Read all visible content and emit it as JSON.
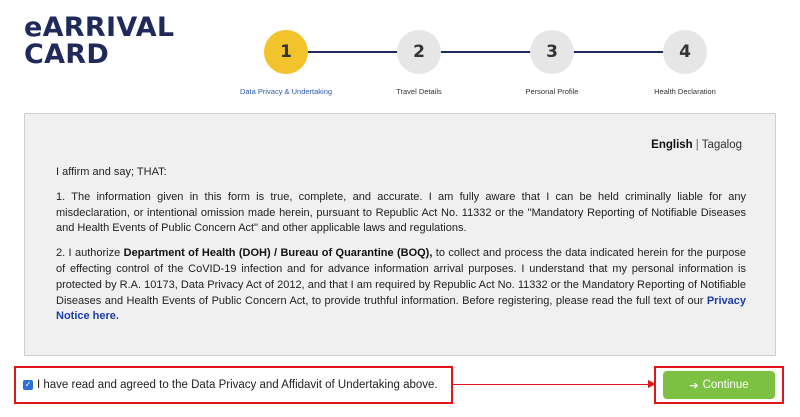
{
  "logo": {
    "line1": "eARRIVAL",
    "line2": "CARD"
  },
  "steps": [
    {
      "number": "1",
      "label": "Data Privacy & Undertaking",
      "active": true
    },
    {
      "number": "2",
      "label": "Travel Details",
      "active": false
    },
    {
      "number": "3",
      "label": "Personal Profile",
      "active": false
    },
    {
      "number": "4",
      "label": "Health Declaration",
      "active": false
    }
  ],
  "language": {
    "selected": "English",
    "separator": "|",
    "alternate": "Tagalog"
  },
  "content": {
    "intro": "I affirm and say; THAT:",
    "para1": "1. The information given in this form is true, complete, and accurate. I am fully aware that I can be held criminally liable for any misdeclaration, or intentional omission made herein, pursuant to Republic Act No. 11332 or the \"Mandatory Reporting of Notifiable Diseases and Health Events of Public Concern Act\" and other applicable laws and regulations.",
    "para2_prefix": "2. I authorize ",
    "para2_org": "Department of Health (DOH) / Bureau of Quarantine (BOQ),",
    "para2_body": " to collect and process the data indicated herein for the purpose of effecting control of the CoVID-19 infection and for advance information arrival purposes. I understand that my personal information is protected by R.A. 10173, Data Privacy Act of 2012, and that I am required by Republic Act No. 11332 or the Mandatory Reporting of Notifiable Diseases and Health Events of Public Concern Act, to provide truthful information. Before registering, please read the full text of our ",
    "privacy_link": "Privacy Notice here."
  },
  "agreement": {
    "checked": true,
    "label": "I have read and agreed to the Data Privacy and Affidavit of Undertaking above."
  },
  "continue_button": {
    "label": "Continue",
    "icon": "arrow-right-icon"
  },
  "colors": {
    "brand_navy": "#1f2a5b",
    "active_step": "#f3c32b",
    "button_green": "#7dc142",
    "highlight_red": "#e0161b"
  }
}
